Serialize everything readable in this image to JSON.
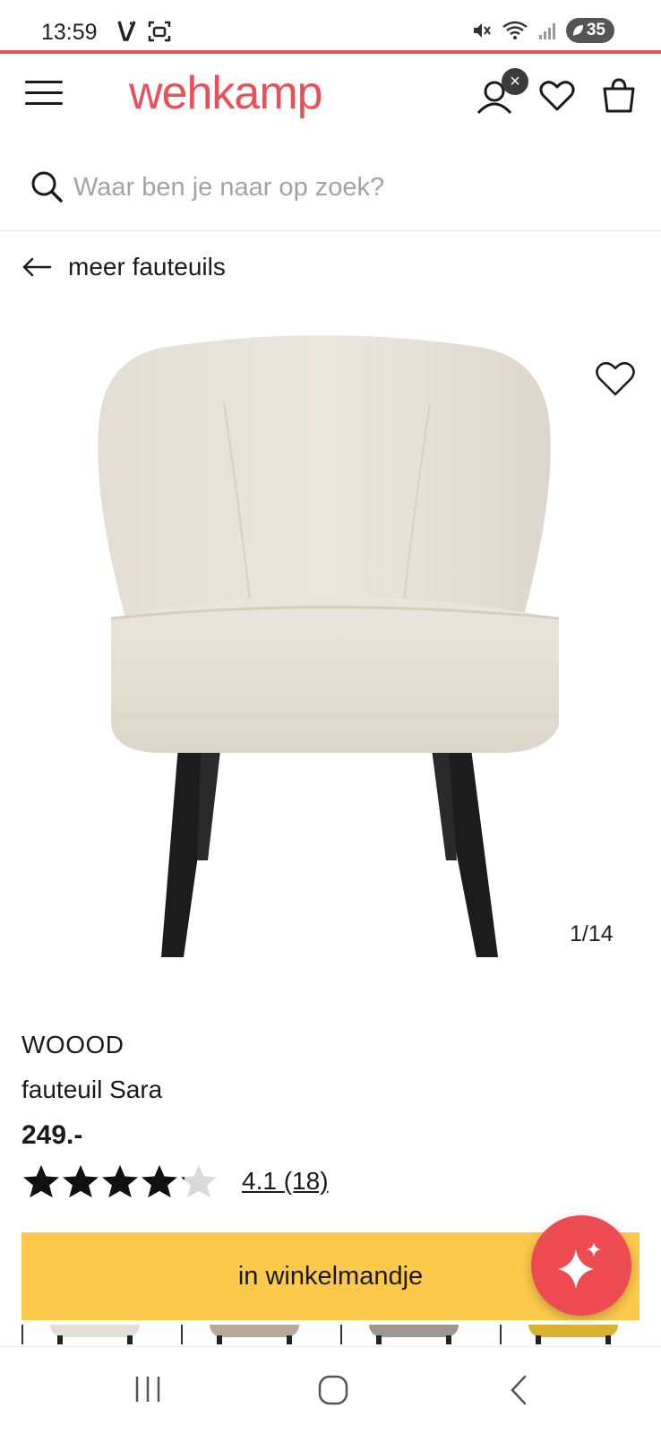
{
  "status_bar": {
    "time": "13:59",
    "battery": "35"
  },
  "header": {
    "logo": "wehkamp",
    "menu_icon": "menu-icon",
    "account_icon": "account-icon",
    "favorites_icon": "heart-icon",
    "cart_icon": "shopping-bag-icon",
    "brand_color": "#e8515a"
  },
  "search": {
    "placeholder": "Waar ben je naar op zoek?"
  },
  "back_link": {
    "label": "meer fauteuils"
  },
  "gallery": {
    "counter": "1/14"
  },
  "product": {
    "brand": "WOOOD",
    "name": "fauteuil Sara",
    "price": "249.-",
    "rating_value": "4.1",
    "rating_count": "(18)",
    "rating_stars": 4.1
  },
  "cta": {
    "label": "in winkelmandje",
    "color": "#fcc94b"
  },
  "fab": {
    "icon": "sparkle-icon",
    "color": "#ee4a52"
  }
}
